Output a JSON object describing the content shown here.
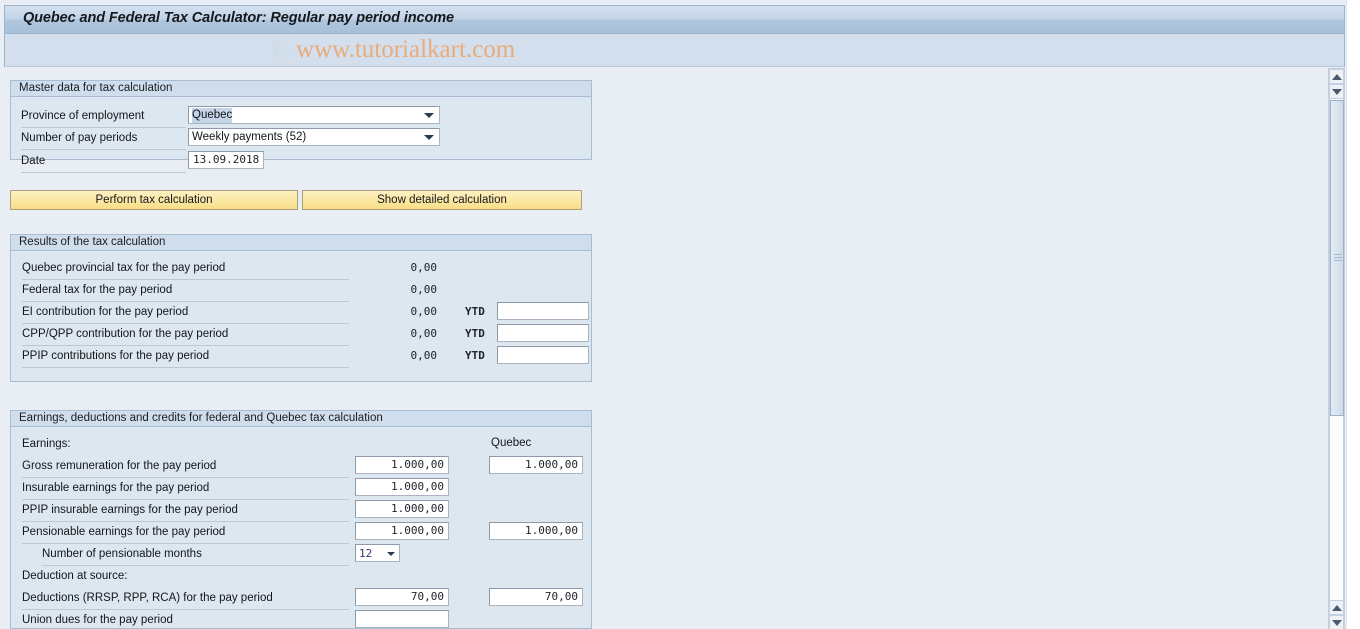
{
  "window": {
    "title": "Quebec and Federal Tax Calculator: Regular pay period income",
    "watermark_copy": "©",
    "watermark_text": " www.tutorialkart.com"
  },
  "master_data": {
    "header": "Master data for tax calculation",
    "fields": [
      {
        "label": "Province of employment",
        "value": "Quebec",
        "type": "combo",
        "selected": true
      },
      {
        "label": "Number of pay periods",
        "value": "Weekly payments (52)",
        "type": "combo",
        "selected": false
      },
      {
        "label": "Date",
        "value": "13.09.2018",
        "type": "text"
      }
    ]
  },
  "actions": {
    "perform": "Perform tax calculation",
    "detailed": "Show detailed calculation"
  },
  "results": {
    "header": "Results of the tax calculation",
    "ytd_label": "YTD",
    "rows": [
      {
        "label": "Quebec provincial tax for the pay period",
        "value": "0,00",
        "has_ytd": false,
        "ytd_value": ""
      },
      {
        "label": "Federal tax for the pay period",
        "value": "0,00",
        "has_ytd": false,
        "ytd_value": ""
      },
      {
        "label": "EI contribution for the pay period",
        "value": "0,00",
        "has_ytd": true,
        "ytd_value": ""
      },
      {
        "label": "CPP/QPP contribution for the pay period",
        "value": "0,00",
        "has_ytd": true,
        "ytd_value": ""
      },
      {
        "label": "PPIP contributions for the pay period",
        "value": "0,00",
        "has_ytd": true,
        "ytd_value": ""
      }
    ]
  },
  "earnings": {
    "header": "Earnings, deductions and credits for federal and Quebec tax calculation",
    "section_earnings": "Earnings:",
    "section_deduction": "Deduction at source:",
    "quebec_column": "Quebec",
    "rows": [
      {
        "label": "Gross remuneration for the pay period",
        "federal": "1.000,00",
        "quebec": "1.000,00",
        "has_quebec": true
      },
      {
        "label": "Insurable earnings for the pay period",
        "federal": "1.000,00",
        "quebec": "",
        "has_quebec": false
      },
      {
        "label": "PPIP insurable earnings for the pay period",
        "federal": "1.000,00",
        "quebec": "",
        "has_quebec": false
      },
      {
        "label": "Pensionable earnings for the pay period",
        "federal": "1.000,00",
        "quebec": "1.000,00",
        "has_quebec": true
      }
    ],
    "pensionable_months": {
      "label": "Number of pensionable months",
      "value": "12"
    },
    "deduction_rows": [
      {
        "label": "Deductions (RRSP, RPP, RCA) for the pay period",
        "federal": "70,00",
        "quebec": "70,00",
        "has_quebec": true
      },
      {
        "label": "Union dues for the pay period",
        "federal": "",
        "quebec": "",
        "has_quebec": false
      }
    ]
  },
  "scrollbars": {
    "outer_up": "scroll-up",
    "outer_down": "scroll-down",
    "inner_up": "scroll-up",
    "inner_down": "scroll-down"
  },
  "colors": {
    "accent": "#a8c0da",
    "panel_bg": "#dde7f0",
    "page_bg": "#e9eef5",
    "button": "#fbe8a4",
    "watermark": "#eaab79"
  }
}
